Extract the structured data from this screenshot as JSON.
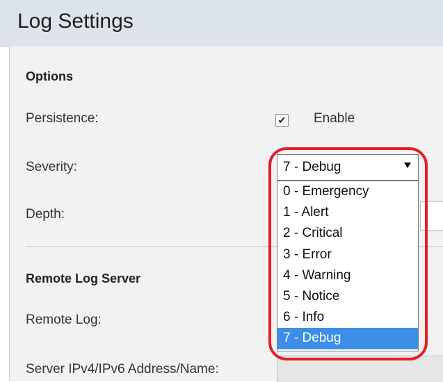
{
  "header": {
    "title": "Log Settings"
  },
  "options": {
    "section_title": "Options",
    "persistence_label": "Persistence:",
    "enable_label": "Enable",
    "enable_checked": true,
    "severity_label": "Severity:",
    "severity_value": "7 - Debug",
    "depth_label": "Depth:"
  },
  "severity_options": [
    "0 - Emergency",
    "1 - Alert",
    "2 - Critical",
    "3 - Error",
    "4 - Warning",
    "5 - Notice",
    "6 - Info",
    "7 - Debug"
  ],
  "remote": {
    "section_title": "Remote Log Server",
    "remote_log_label": "Remote Log:",
    "server_address_label": "Server IPv4/IPv6 Address/Name:"
  },
  "colors": {
    "highlight_ring": "#e0202a",
    "selected_option": "#3c8ee6"
  }
}
